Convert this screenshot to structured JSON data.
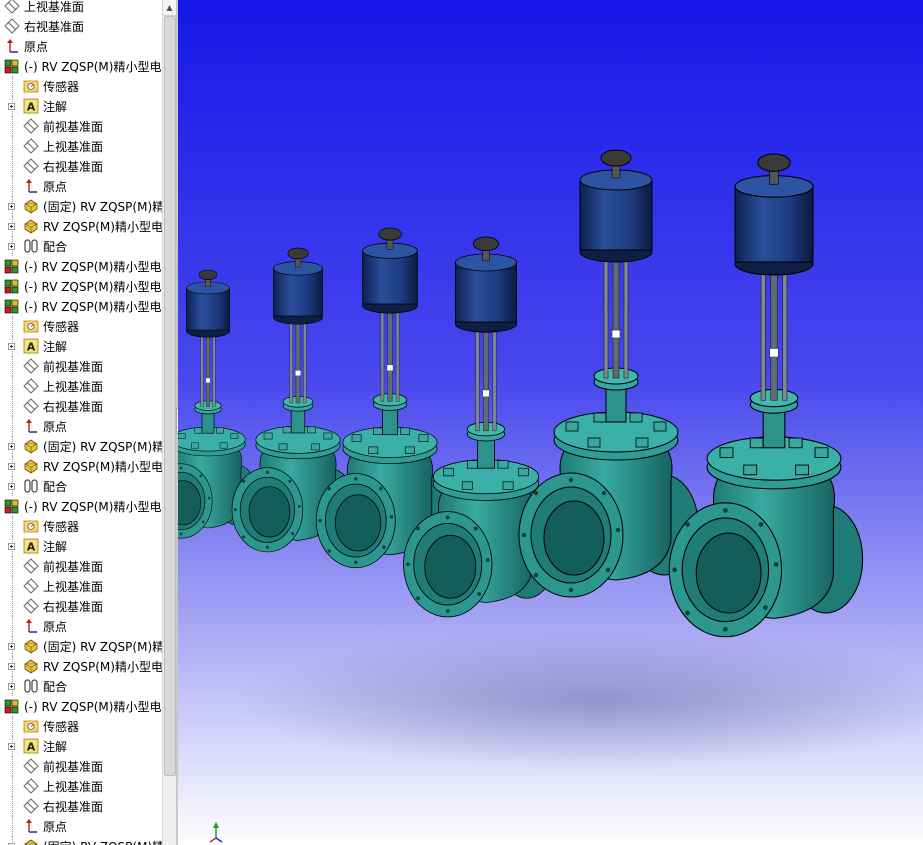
{
  "tree": {
    "items": [
      {
        "label": "上视基准面",
        "icon": "plane-icon",
        "indent": 0,
        "expander": false
      },
      {
        "label": "右视基准面",
        "icon": "plane-icon",
        "indent": 0,
        "expander": false
      },
      {
        "label": "原点",
        "icon": "origin-icon",
        "indent": 0,
        "expander": false
      },
      {
        "label": "(-) RV ZQSP(M)精小型电",
        "icon": "subassembly-icon",
        "indent": 0,
        "expander": false
      },
      {
        "label": "传感器",
        "icon": "sensor-folder-icon",
        "indent": 1,
        "expander": false
      },
      {
        "label": "注解",
        "icon": "annotation-icon",
        "indent": 1,
        "expander": true
      },
      {
        "label": "前视基准面",
        "icon": "plane-icon",
        "indent": 1,
        "expander": false
      },
      {
        "label": "上视基准面",
        "icon": "plane-icon",
        "indent": 1,
        "expander": false
      },
      {
        "label": "右视基准面",
        "icon": "plane-icon",
        "indent": 1,
        "expander": false
      },
      {
        "label": "原点",
        "icon": "origin-icon",
        "indent": 1,
        "expander": false
      },
      {
        "label": "(固定) RV ZQSP(M)精",
        "icon": "part-icon",
        "indent": 1,
        "expander": true
      },
      {
        "label": "RV ZQSP(M)精小型电",
        "icon": "part-icon",
        "indent": 1,
        "expander": true
      },
      {
        "label": "配合",
        "icon": "mate-icon",
        "indent": 1,
        "expander": true
      },
      {
        "label": "(-) RV ZQSP(M)精小型电",
        "icon": "subassembly-icon",
        "indent": 0,
        "expander": false
      },
      {
        "label": "(-) RV ZQSP(M)精小型电",
        "icon": "subassembly-icon",
        "indent": 0,
        "expander": false
      },
      {
        "label": "(-) RV ZQSP(M)精小型电",
        "icon": "subassembly-icon",
        "indent": 0,
        "expander": false
      },
      {
        "label": "传感器",
        "icon": "sensor-folder-icon",
        "indent": 1,
        "expander": false
      },
      {
        "label": "注解",
        "icon": "annotation-icon",
        "indent": 1,
        "expander": true
      },
      {
        "label": "前视基准面",
        "icon": "plane-icon",
        "indent": 1,
        "expander": false
      },
      {
        "label": "上视基准面",
        "icon": "plane-icon",
        "indent": 1,
        "expander": false
      },
      {
        "label": "右视基准面",
        "icon": "plane-icon",
        "indent": 1,
        "expander": false
      },
      {
        "label": "原点",
        "icon": "origin-icon",
        "indent": 1,
        "expander": false
      },
      {
        "label": "(固定) RV ZQSP(M)精",
        "icon": "part-icon",
        "indent": 1,
        "expander": true
      },
      {
        "label": "RV ZQSP(M)精小型电",
        "icon": "part-icon",
        "indent": 1,
        "expander": true
      },
      {
        "label": "配合",
        "icon": "mate-icon",
        "indent": 1,
        "expander": true
      },
      {
        "label": "(-) RV ZQSP(M)精小型电",
        "icon": "subassembly-icon",
        "indent": 0,
        "expander": false
      },
      {
        "label": "传感器",
        "icon": "sensor-folder-icon",
        "indent": 1,
        "expander": false
      },
      {
        "label": "注解",
        "icon": "annotation-icon",
        "indent": 1,
        "expander": true
      },
      {
        "label": "前视基准面",
        "icon": "plane-icon",
        "indent": 1,
        "expander": false
      },
      {
        "label": "上视基准面",
        "icon": "plane-icon",
        "indent": 1,
        "expander": false
      },
      {
        "label": "右视基准面",
        "icon": "plane-icon",
        "indent": 1,
        "expander": false
      },
      {
        "label": "原点",
        "icon": "origin-icon",
        "indent": 1,
        "expander": false
      },
      {
        "label": "(固定) RV ZQSP(M)精",
        "icon": "part-icon",
        "indent": 1,
        "expander": true
      },
      {
        "label": "RV ZQSP(M)精小型电",
        "icon": "part-icon",
        "indent": 1,
        "expander": true
      },
      {
        "label": "配合",
        "icon": "mate-icon",
        "indent": 1,
        "expander": true
      },
      {
        "label": "(-) RV ZQSP(M)精小型电",
        "icon": "subassembly-icon",
        "indent": 0,
        "expander": false
      },
      {
        "label": "传感器",
        "icon": "sensor-folder-icon",
        "indent": 1,
        "expander": false
      },
      {
        "label": "注解",
        "icon": "annotation-icon",
        "indent": 1,
        "expander": true
      },
      {
        "label": "前视基准面",
        "icon": "plane-icon",
        "indent": 1,
        "expander": false
      },
      {
        "label": "上视基准面",
        "icon": "plane-icon",
        "indent": 1,
        "expander": false
      },
      {
        "label": "右视基准面",
        "icon": "plane-icon",
        "indent": 1,
        "expander": false
      },
      {
        "label": "原点",
        "icon": "origin-icon",
        "indent": 1,
        "expander": false
      },
      {
        "label": "(固定) RV ZQSP(M)精",
        "icon": "part-icon",
        "indent": 1,
        "expander": true
      }
    ]
  },
  "viewport": {
    "background_top": "#1a1ae6",
    "background_bottom": "#ffffff",
    "model_colors": {
      "body": "#2e9a93",
      "body_shadow": "#17605c",
      "actuator": "#1f3f86",
      "actuator_dark": "#0f2456",
      "stem": "#6f7f85"
    },
    "valves": [
      {
        "label": "valve-1",
        "scale": 0.6
      },
      {
        "label": "valve-2",
        "scale": 0.68
      },
      {
        "label": "valve-3",
        "scale": 0.76
      },
      {
        "label": "valve-4",
        "scale": 0.85
      },
      {
        "label": "valve-5",
        "scale": 1.0
      },
      {
        "label": "valve-6",
        "scale": 1.08
      }
    ]
  },
  "scrollbar": {
    "arrow_icon": "scroll-up-arrow-icon"
  },
  "splitter": {
    "icon": "collapse-panel-icon"
  },
  "triad": {
    "icon": "axis-triad-icon"
  }
}
